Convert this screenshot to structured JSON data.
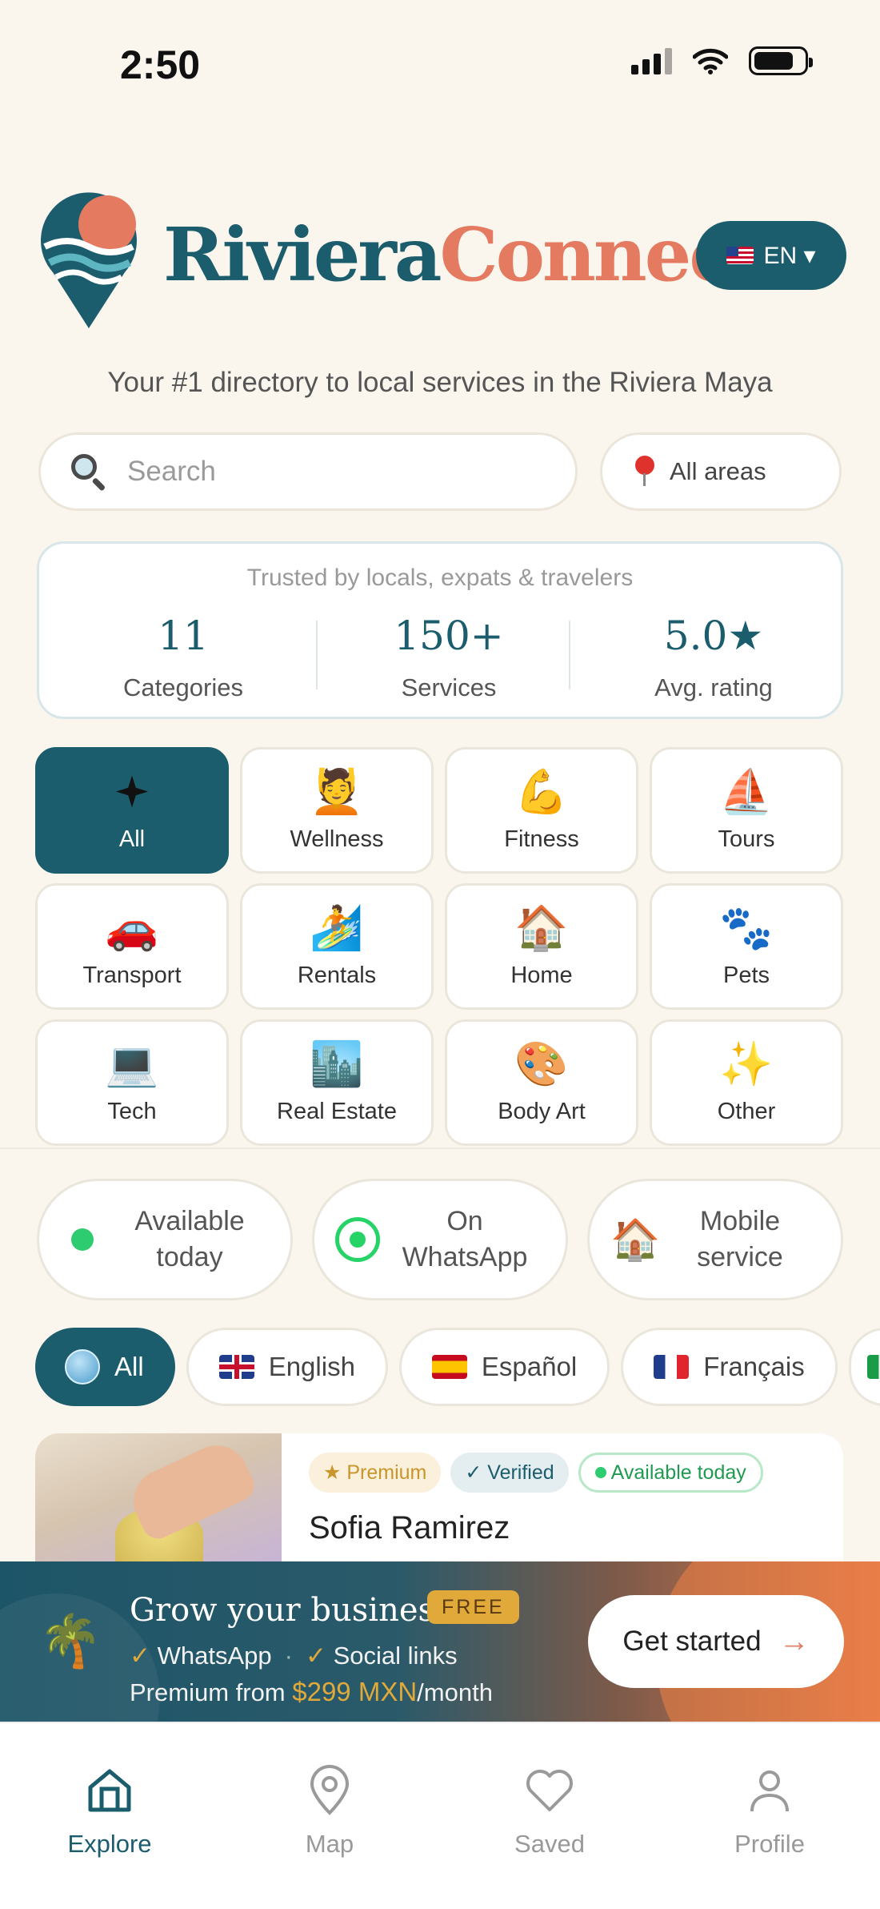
{
  "status_bar": {
    "time": "2:50"
  },
  "header": {
    "brand_part1": "Riviera",
    "brand_part2": "Connect",
    "language_button": "EN ▾"
  },
  "tagline": "Your #1 directory to local services in the Riviera Maya",
  "search": {
    "placeholder": "Search",
    "area_label": "All areas"
  },
  "stats": {
    "caption": "Trusted by locals, expats & travelers",
    "items": [
      {
        "value": "11",
        "label": "Categories"
      },
      {
        "value": "150+",
        "label": "Services"
      },
      {
        "value": "5.0★",
        "label": "Avg. rating"
      }
    ]
  },
  "categories": [
    {
      "label": "All",
      "icon": "sparkle-icon",
      "emoji": "",
      "active": true
    },
    {
      "label": "Wellness",
      "icon": "massage-icon",
      "emoji": "💆"
    },
    {
      "label": "Fitness",
      "icon": "flexed-biceps-icon",
      "emoji": "💪"
    },
    {
      "label": "Tours",
      "icon": "sailboat-icon",
      "emoji": "⛵"
    },
    {
      "label": "Transport",
      "icon": "car-icon",
      "emoji": "🚗"
    },
    {
      "label": "Rentals",
      "icon": "surfer-icon",
      "emoji": "🏄"
    },
    {
      "label": "Home",
      "icon": "house-icon",
      "emoji": "🏠"
    },
    {
      "label": "Pets",
      "icon": "paw-prints-icon",
      "emoji": "🐾"
    },
    {
      "label": "Tech",
      "icon": "laptop-icon",
      "emoji": "💻"
    },
    {
      "label": "Real Estate",
      "icon": "city-buildings-icon",
      "emoji": "🏙️"
    },
    {
      "label": "Body Art",
      "icon": "palette-icon",
      "emoji": "🎨"
    },
    {
      "label": "Other",
      "icon": "sparkles-icon",
      "emoji": "✨"
    }
  ],
  "filters": [
    {
      "label": "Available\ntoday",
      "icon": "green-dot-icon"
    },
    {
      "label": "On\nWhatsApp",
      "icon": "whatsapp-icon"
    },
    {
      "label": "Mobile\nservice",
      "icon": "house-icon",
      "emoji": "🏠"
    }
  ],
  "languages": [
    {
      "label": "All",
      "icon": "globe-icon",
      "active": true
    },
    {
      "label": "English",
      "icon": "flag-gb-icon"
    },
    {
      "label": "Español",
      "icon": "flag-es-icon"
    },
    {
      "label": "Français",
      "icon": "flag-fr-icon"
    }
  ],
  "listing": {
    "name": "Sofia Ramirez",
    "badge_premium": "★ Premium",
    "badge_verified": "✓ Verified",
    "badge_available": "Available today"
  },
  "promo": {
    "title": "Grow your business",
    "free_badge": "FREE",
    "feature1": "WhatsApp",
    "feature2": "Social links",
    "price_prefix": "Premium from ",
    "price_amount": "$299 MXN",
    "price_suffix": "/month",
    "cta": "Get started"
  },
  "tabs": [
    {
      "label": "Explore",
      "icon": "home-icon",
      "active": true
    },
    {
      "label": "Map",
      "icon": "map-pin-icon"
    },
    {
      "label": "Saved",
      "icon": "heart-icon"
    },
    {
      "label": "Profile",
      "icon": "person-icon"
    }
  ],
  "colors": {
    "primary": "#1c5d6d",
    "accent": "#e47a5f",
    "background": "#faf6ee",
    "gold": "#e0a93a",
    "available_green": "#2ecc71"
  }
}
